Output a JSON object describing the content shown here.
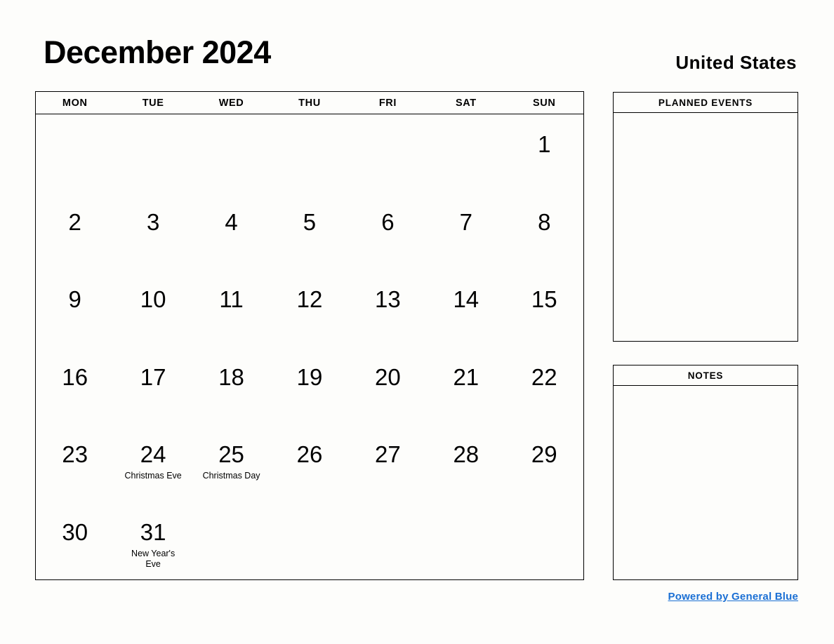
{
  "header": {
    "month_title": "December 2024",
    "country": "United States"
  },
  "calendar": {
    "weekdays": [
      "MON",
      "TUE",
      "WED",
      "THU",
      "FRI",
      "SAT",
      "SUN"
    ],
    "weeks": [
      [
        {
          "day": "",
          "event": ""
        },
        {
          "day": "",
          "event": ""
        },
        {
          "day": "",
          "event": ""
        },
        {
          "day": "",
          "event": ""
        },
        {
          "day": "",
          "event": ""
        },
        {
          "day": "",
          "event": ""
        },
        {
          "day": "1",
          "event": ""
        }
      ],
      [
        {
          "day": "2",
          "event": ""
        },
        {
          "day": "3",
          "event": ""
        },
        {
          "day": "4",
          "event": ""
        },
        {
          "day": "5",
          "event": ""
        },
        {
          "day": "6",
          "event": ""
        },
        {
          "day": "7",
          "event": ""
        },
        {
          "day": "8",
          "event": ""
        }
      ],
      [
        {
          "day": "9",
          "event": ""
        },
        {
          "day": "10",
          "event": ""
        },
        {
          "day": "11",
          "event": ""
        },
        {
          "day": "12",
          "event": ""
        },
        {
          "day": "13",
          "event": ""
        },
        {
          "day": "14",
          "event": ""
        },
        {
          "day": "15",
          "event": ""
        }
      ],
      [
        {
          "day": "16",
          "event": ""
        },
        {
          "day": "17",
          "event": ""
        },
        {
          "day": "18",
          "event": ""
        },
        {
          "day": "19",
          "event": ""
        },
        {
          "day": "20",
          "event": ""
        },
        {
          "day": "21",
          "event": ""
        },
        {
          "day": "22",
          "event": ""
        }
      ],
      [
        {
          "day": "23",
          "event": ""
        },
        {
          "day": "24",
          "event": "Christmas Eve"
        },
        {
          "day": "25",
          "event": "Christmas Day"
        },
        {
          "day": "26",
          "event": ""
        },
        {
          "day": "27",
          "event": ""
        },
        {
          "day": "28",
          "event": ""
        },
        {
          "day": "29",
          "event": ""
        }
      ],
      [
        {
          "day": "30",
          "event": ""
        },
        {
          "day": "31",
          "event": "New Year's Eve"
        },
        {
          "day": "",
          "event": ""
        },
        {
          "day": "",
          "event": ""
        },
        {
          "day": "",
          "event": ""
        },
        {
          "day": "",
          "event": ""
        },
        {
          "day": "",
          "event": ""
        }
      ]
    ]
  },
  "panels": {
    "planned_events": {
      "title": "PLANNED EVENTS",
      "content": ""
    },
    "notes": {
      "title": "NOTES",
      "content": ""
    }
  },
  "footer": {
    "credit_text": "Powered by General Blue",
    "link_color": "#1a6fd4"
  }
}
